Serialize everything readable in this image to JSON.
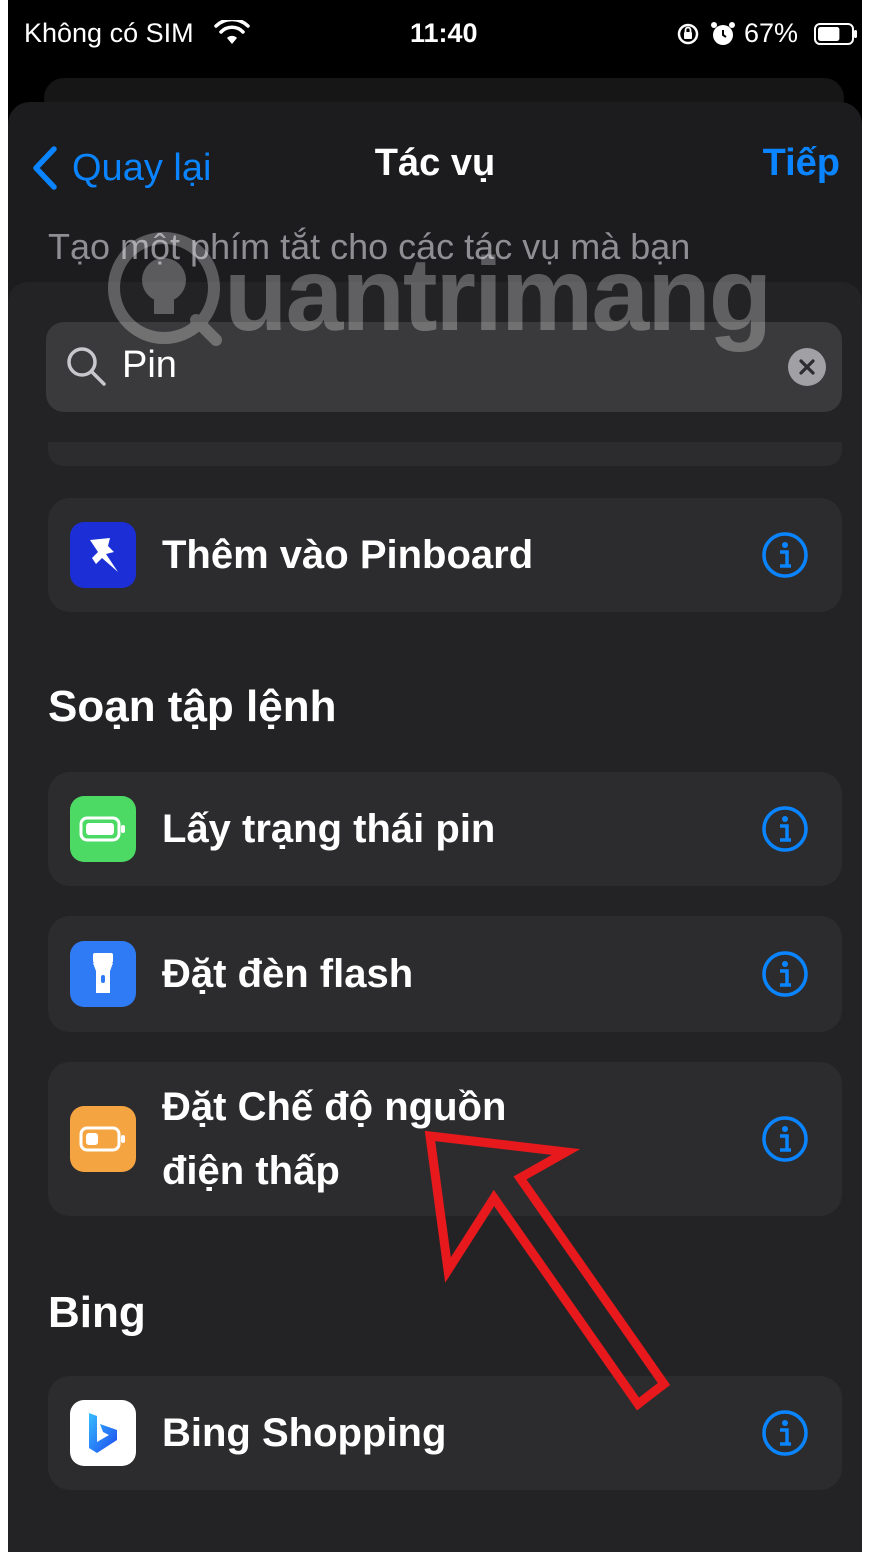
{
  "status_bar": {
    "carrier": "Không có SIM",
    "time": "11:40",
    "battery_percent": "67%",
    "battery_level": 0.67,
    "icons": [
      "wifi-icon",
      "orientation-lock-icon",
      "alarm-icon",
      "battery-icon"
    ]
  },
  "nav": {
    "back_label": "Quay lại",
    "title": "Tác vụ",
    "next_label": "Tiếp"
  },
  "subtitle": "Tạo một phím tắt cho các tác vụ mà bạn",
  "search": {
    "value": "Pin",
    "placeholder": ""
  },
  "sections": [
    {
      "header": "",
      "items": [
        {
          "label": "Thêm vào Pinboard",
          "icon": "pinboard-icon",
          "icon_color": "#1c2fd6"
        }
      ]
    },
    {
      "header": "Soạn tập lệnh",
      "items": [
        {
          "label": "Lấy trạng thái pin",
          "icon": "battery-status-icon",
          "icon_color": "#4cd964"
        },
        {
          "label": "Đặt đèn flash",
          "icon": "flashlight-icon",
          "icon_color": "#2f7bf5"
        },
        {
          "label_line1": "Đặt Chế độ nguồn",
          "label_line2": "điện thấp",
          "icon": "low-power-icon",
          "icon_color": "#f5a442"
        }
      ]
    },
    {
      "header": "Bing",
      "items": [
        {
          "label": "Bing Shopping",
          "icon": "bing-logo-icon",
          "icon_color": "#ffffff"
        }
      ]
    }
  ],
  "watermark": "uantrimang",
  "colors": {
    "accent": "#0a84ff",
    "annotation_arrow": "#e8191c",
    "background": "#1c1c1e"
  }
}
